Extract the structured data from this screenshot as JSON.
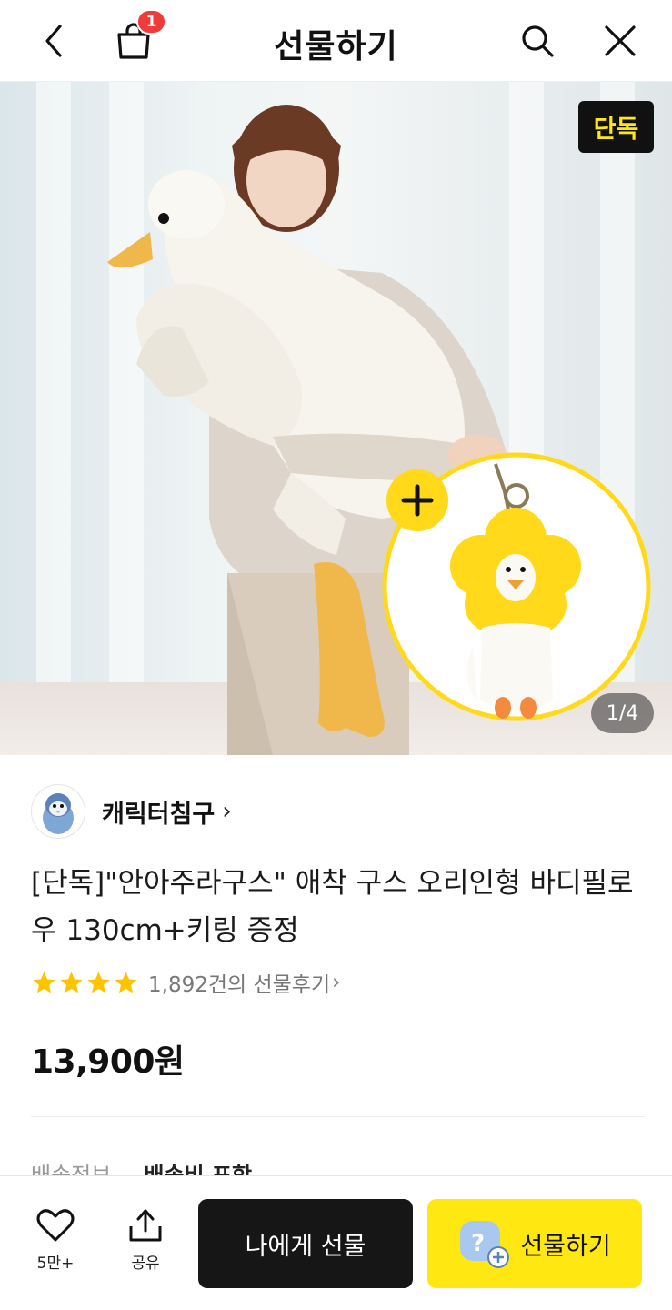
{
  "header": {
    "title": "선물하기",
    "cart_badge": "1",
    "icons": [
      "back-icon",
      "shopping-bag-icon",
      "search-icon",
      "close-icon"
    ]
  },
  "hero": {
    "exclusive_badge": "단독",
    "page_counter": "1/4",
    "colors": {
      "badge_text": "#ffe812",
      "keyring_yellow": "#ffd91a"
    }
  },
  "seller": {
    "name": "캐릭터침구",
    "chevron": "›"
  },
  "product": {
    "title": "[단독]\"안아주라구스\" 애착 구스 오리인형 바디필로우 130cm+키링 증정",
    "rating_stars": 4,
    "review_text": "1,892건의 선물후기",
    "review_chevron": "›",
    "price": "13,900원"
  },
  "shipping": {
    "label": "배송정보",
    "value": "배송비 포함"
  },
  "bottom_bar": {
    "like_count": "5만+",
    "share_label": "공유",
    "gift_self_label": "나에게 선물",
    "gift_label": "선물하기"
  }
}
